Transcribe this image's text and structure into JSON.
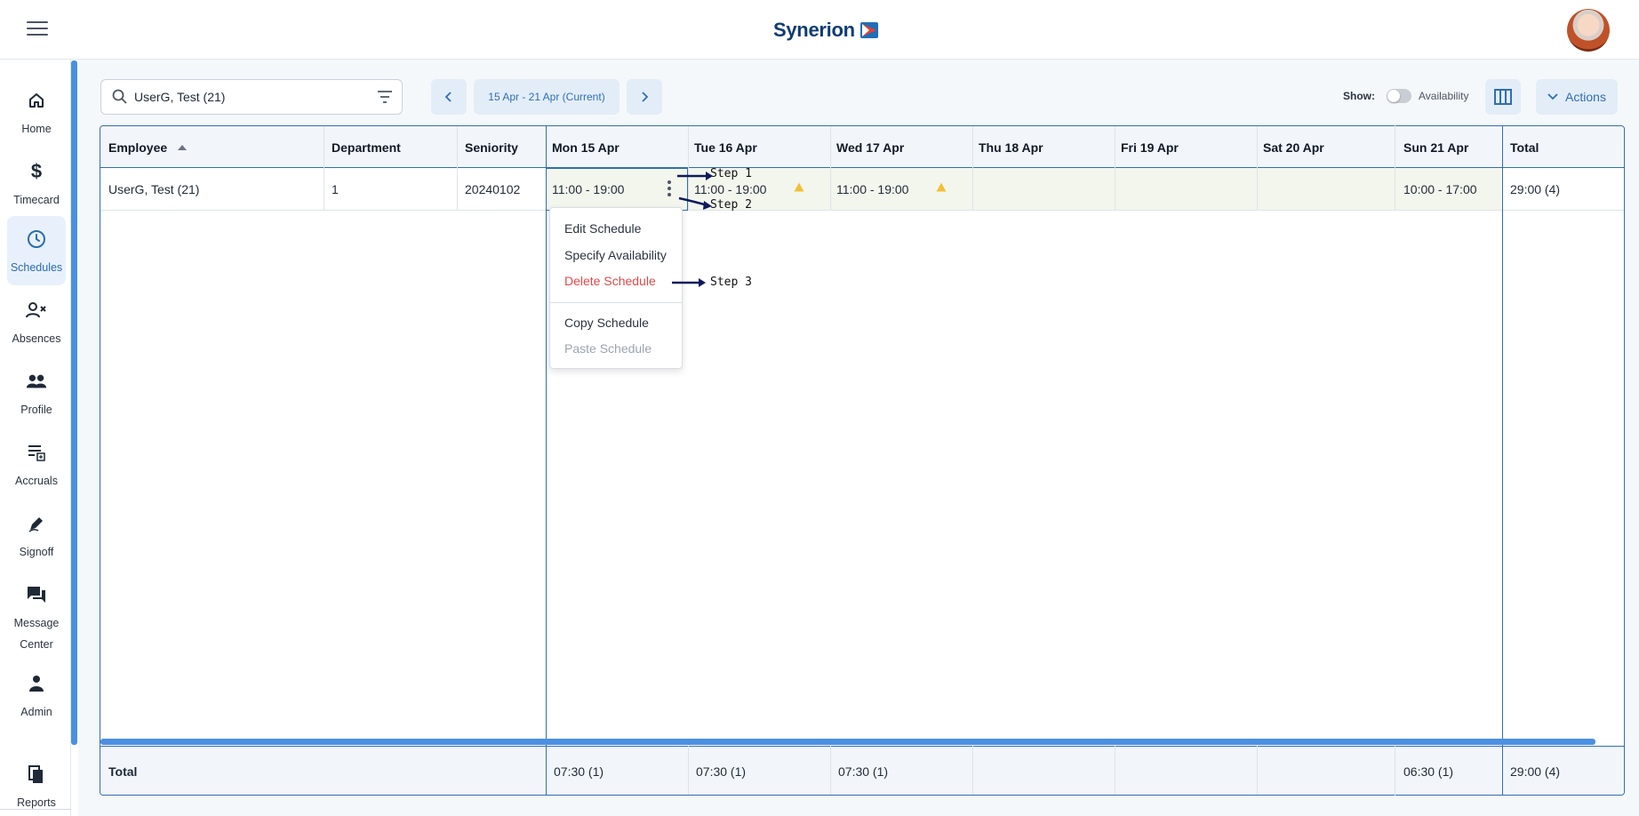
{
  "header": {
    "brand": "Synerion"
  },
  "nav": {
    "items": [
      {
        "label": "Home",
        "icon": "home-icon"
      },
      {
        "label": "Timecard",
        "icon": "dollar-icon"
      },
      {
        "label": "Schedules",
        "icon": "clock-icon",
        "active": true
      },
      {
        "label": "Absences",
        "icon": "person-remove-icon"
      },
      {
        "label": "Profile",
        "icon": "people-icon"
      },
      {
        "label": "Accruals",
        "icon": "accruals-icon"
      },
      {
        "label": "Signoff",
        "icon": "signoff-icon"
      },
      {
        "label_line1": "Message",
        "label_line2": "Center",
        "icon": "chat-icon"
      },
      {
        "label": "Admin",
        "icon": "person-icon"
      },
      {
        "label": "Reports",
        "icon": "documents-icon"
      }
    ]
  },
  "toolbar": {
    "search_value": "UserG, Test (21)",
    "date_range": "15 Apr - 21 Apr (Current)",
    "show_label": "Show:",
    "availability_label": "Availability",
    "availability_on": false,
    "actions_label": "Actions"
  },
  "table": {
    "columns": [
      "Employee",
      "Department",
      "Seniority",
      "Mon 15 Apr",
      "Tue 16 Apr",
      "Wed 17 Apr",
      "Thu 18 Apr",
      "Fri 19 Apr",
      "Sat 20 Apr",
      "Sun 21 Apr",
      "Total"
    ],
    "sort_column": "Employee",
    "rows": [
      {
        "employee": "UserG, Test (21)",
        "department": "1",
        "seniority": "20240102",
        "mon": "11:00 - 19:00",
        "tue": "11:00 - 19:00",
        "wed": "11:00 - 19:00",
        "thu": "",
        "fri": "",
        "sat": "",
        "sun": "10:00 - 17:00",
        "total": "29:00 (4)"
      }
    ],
    "totals": {
      "label": "Total",
      "mon": "07:30 (1)",
      "tue": "07:30 (1)",
      "wed": "07:30 (1)",
      "thu": "",
      "fri": "",
      "sat": "",
      "sun": "06:30 (1)",
      "total": "29:00 (4)"
    }
  },
  "context_menu": {
    "items": [
      "Edit Schedule",
      "Specify Availability",
      "Delete Schedule",
      "Copy Schedule",
      "Paste Schedule"
    ]
  },
  "annotations": [
    "Step 1",
    "Step 2",
    "Step 3"
  ],
  "colors": {
    "accent": "#2f6eb5",
    "delete": "#e04848",
    "warning": "#f2c037",
    "row_tint": "#f3f6ed"
  }
}
